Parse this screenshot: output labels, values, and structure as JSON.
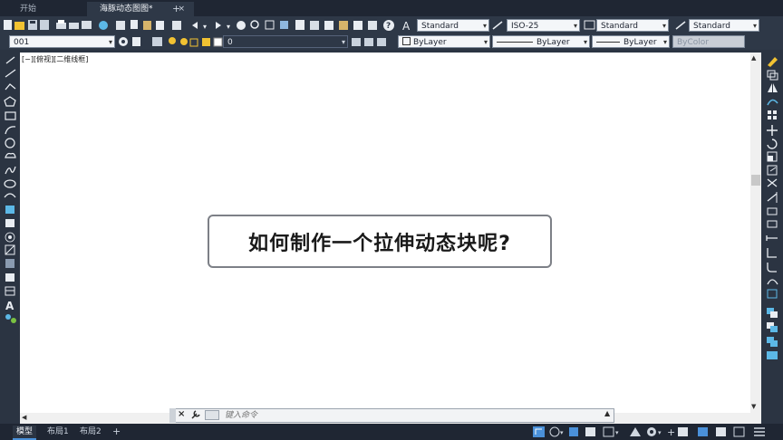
{
  "tabs": {
    "start_label": "开始",
    "drawing_label": "海豚动态图图*",
    "close_glyph": "×",
    "add_glyph": "+"
  },
  "toolbar": {
    "text_style": "Standard",
    "dim_style": "ISO-25",
    "table_style": "Standard",
    "mleader_style": "Standard",
    "layer_name": "001",
    "current_layer": "0",
    "color_value": "ByLayer",
    "linetype_value": "ByLayer",
    "lineweight_value": "ByLayer",
    "plotstyle_value": "ByColor",
    "help_glyph": "?"
  },
  "viewport": {
    "label": "[−][俯视][二维线框]"
  },
  "banner": {
    "text": "如何制作一个拉伸动态块呢?"
  },
  "command": {
    "placeholder": "键入命令",
    "close_glyph": "×",
    "wrench_glyph": "🔧",
    "up_glyph": "▲"
  },
  "layout_tabs": {
    "model": "模型",
    "layout1": "布局1",
    "layout2": "布局2",
    "add": "+"
  },
  "colors": {
    "ui_dark": "#2b3442",
    "tab_bar": "#1f2633",
    "canvas": "#ffffff",
    "accent_blue": "#4a90d9",
    "icon_yellow": "#f1c232",
    "banner_border": "#7d8087"
  }
}
